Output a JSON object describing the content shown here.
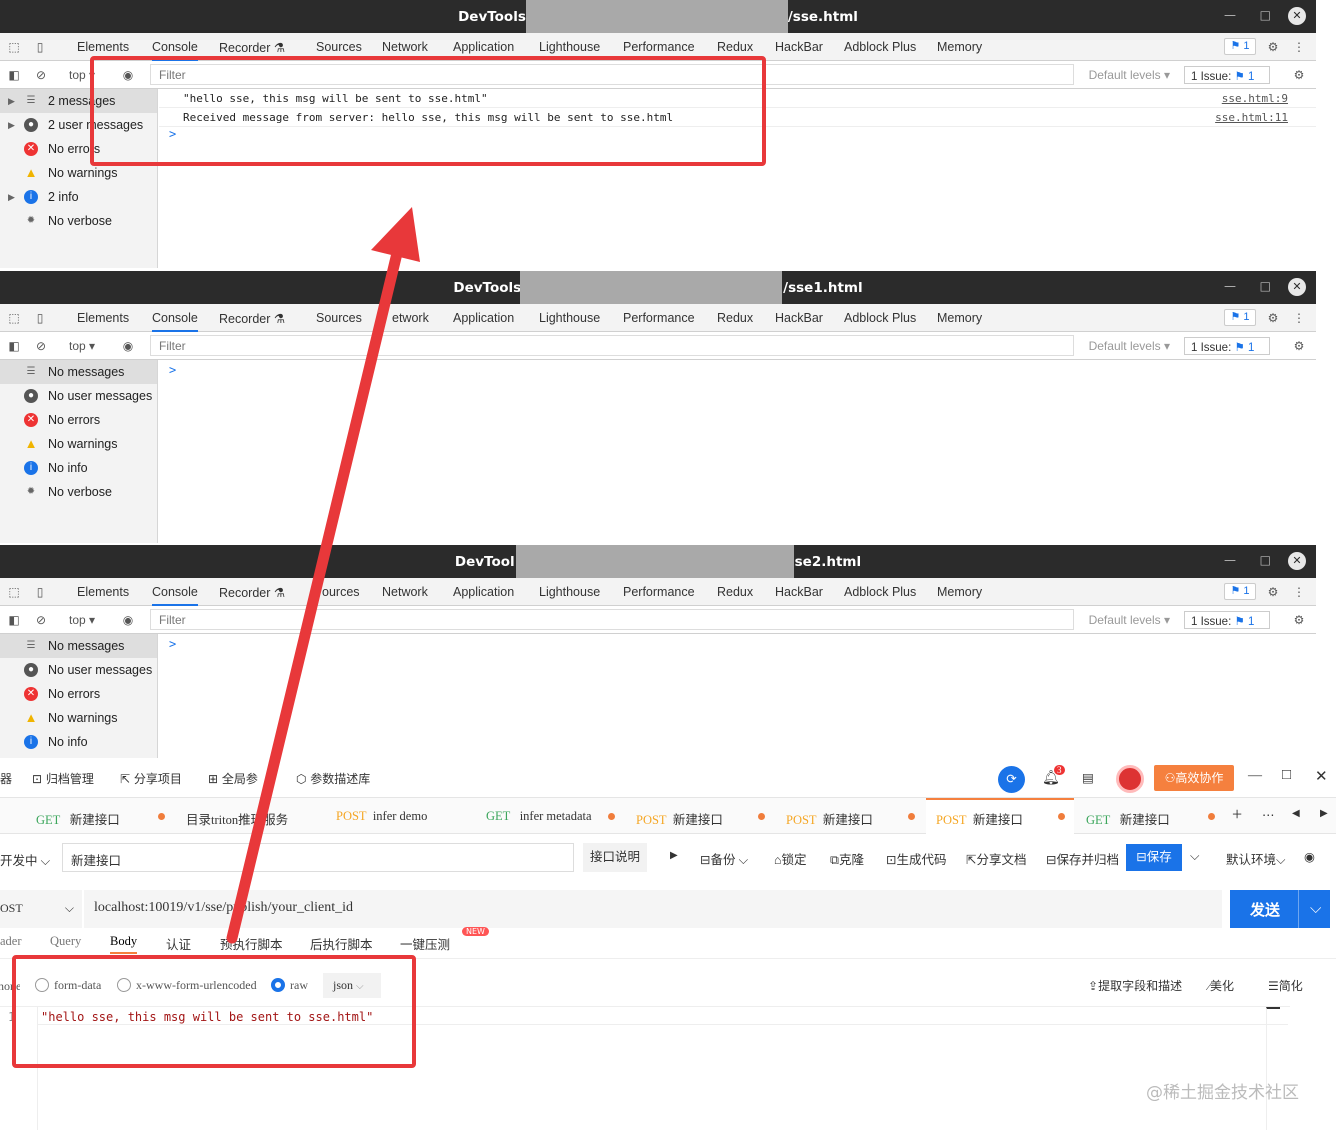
{
  "windows": [
    {
      "title_left": "DevTools",
      "title_right": "/sse.html",
      "min": "—",
      "max": "□",
      "close": "✕"
    },
    {
      "title_left": "DevTools",
      "title_right": "/sse1.html",
      "min": "—",
      "max": "□",
      "close": "✕"
    },
    {
      "title_left": "DevTool",
      "title_right": "se2.html",
      "min": "—",
      "max": "□",
      "close": "✕"
    }
  ],
  "tabs": [
    "Elements",
    "Console",
    "Recorder ⚗",
    "Sources",
    "Network",
    "Application",
    "Lighthouse",
    "Performance",
    "Redux",
    "HackBar",
    "Adblock Plus",
    "Memory"
  ],
  "tabs3_sources": "ources",
  "tabs2_network": "etwork",
  "badge": "1",
  "filter": {
    "top": "top ▾",
    "placeholder": "Filter",
    "levels": "Default levels ▾",
    "issue": "1 Issue:",
    "issue_count": "1"
  },
  "side1": [
    "2 messages",
    "2 user messages",
    "No errors",
    "No warnings",
    "2 info",
    "No verbose"
  ],
  "side2": [
    "No messages",
    "No user messages",
    "No errors",
    "No warnings",
    "No info",
    "No verbose"
  ],
  "side3": [
    "No messages",
    "No user messages",
    "No errors",
    "No warnings",
    "No info"
  ],
  "console1": [
    {
      "text": "\"hello sse, this msg will be sent to sse.html\"",
      "src": "sse.html:9"
    },
    {
      "text": "Received message from server: hello sse, this msg will be sent to sse.html",
      "src": "sse.html:11"
    }
  ],
  "prompt": ">",
  "api": {
    "toolbar": [
      "器",
      "归档管理",
      "分享项目",
      "全局参",
      "参数描述库"
    ],
    "notif": "3",
    "collab": "高效协作",
    "request_tabs": [
      {
        "method": "GET",
        "name": "新建接口"
      },
      {
        "method": "",
        "name": "目录triton推理服务"
      },
      {
        "method": "POST",
        "name": "infer demo"
      },
      {
        "method": "GET",
        "name": "infer metadata"
      },
      {
        "method": "POST",
        "name": "新建接口"
      },
      {
        "method": "POST",
        "name": "新建接口"
      },
      {
        "method": "POST",
        "name": "新建接口"
      },
      {
        "method": "GET",
        "name": "新建接口"
      }
    ],
    "env_left": "开发中",
    "name_value": "新建接口",
    "doc_btn": "接口说明",
    "actions": [
      "备份",
      "锁定",
      "克隆",
      "生成代码",
      "分享文档",
      "保存并归档"
    ],
    "save": "保存",
    "env": "默认环境",
    "method": "OST",
    "url": "localhost:10019/v1/sse/publish/your_client_id",
    "send": "发送",
    "sub_tabs": [
      "ader",
      "Query",
      "Body",
      "认证",
      "预执行脚本",
      "后执行脚本",
      "一键压测"
    ],
    "new_badge": "NEW",
    "body_opts": [
      "none",
      "form-data",
      "x-www-form-urlencoded",
      "raw"
    ],
    "format": "json",
    "right_tools": [
      "提取字段和描述",
      "美化",
      "简化"
    ],
    "line_no": "1",
    "body_text": "\"hello sse, this msg will be sent to sse.html\"",
    "watermark": "@稀土掘金技术社区"
  }
}
